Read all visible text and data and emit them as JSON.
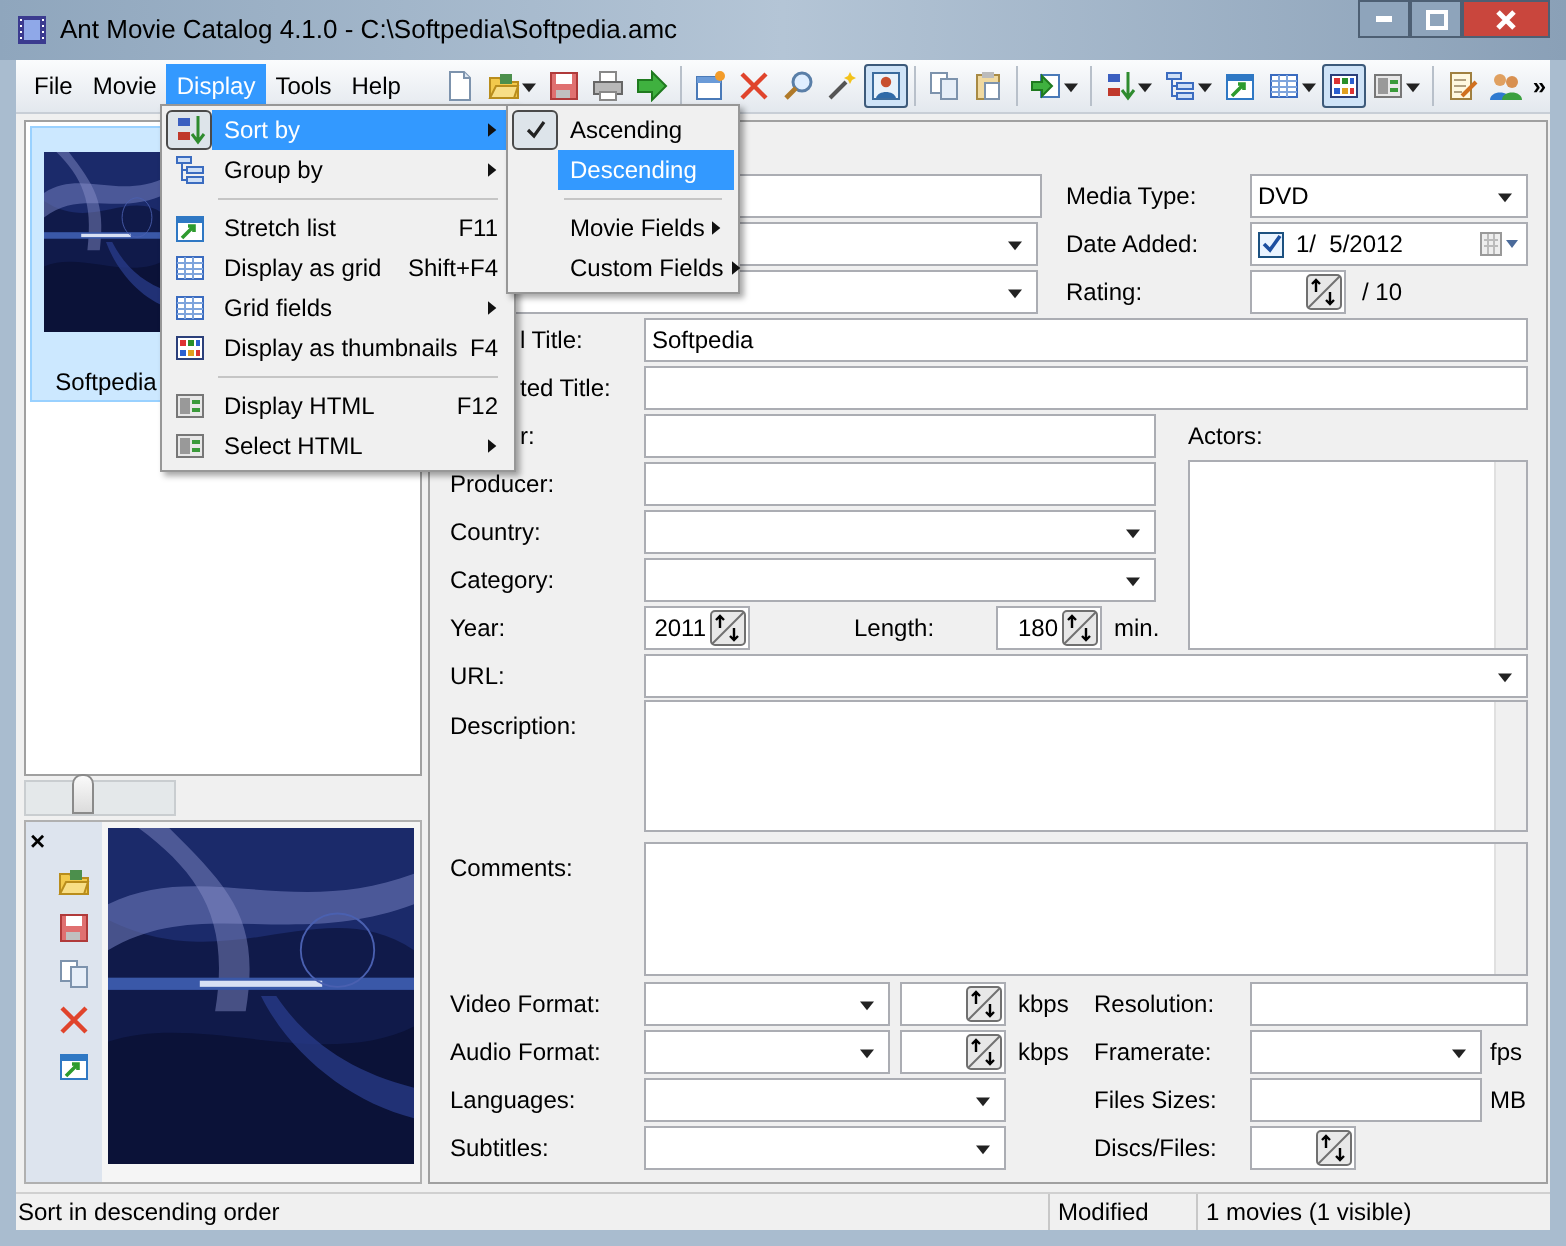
{
  "window": {
    "title": "Ant Movie Catalog 4.1.0 - C:\\Softpedia\\Softpedia.amc"
  },
  "menu_bar": [
    {
      "label": "File",
      "selected": false
    },
    {
      "label": "Movie",
      "selected": false
    },
    {
      "label": "Display",
      "selected": true
    },
    {
      "label": "Tools",
      "selected": false
    },
    {
      "label": "Help",
      "selected": false
    }
  ],
  "toolbar": [
    {
      "kind": "new",
      "selected": false,
      "dropdown": false
    },
    {
      "kind": "open",
      "selected": false,
      "dropdown": true
    },
    {
      "kind": "save",
      "selected": false,
      "dropdown": false
    },
    {
      "kind": "print",
      "selected": false,
      "dropdown": false
    },
    {
      "kind": "run",
      "selected": false,
      "dropdown": false
    },
    {
      "kind": "sep"
    },
    {
      "kind": "add",
      "selected": false,
      "dropdown": false
    },
    {
      "kind": "delete",
      "selected": false,
      "dropdown": false
    },
    {
      "kind": "find",
      "selected": false,
      "dropdown": false
    },
    {
      "kind": "wand",
      "selected": false,
      "dropdown": false
    },
    {
      "kind": "portrait",
      "selected": true,
      "dropdown": false
    },
    {
      "kind": "sep"
    },
    {
      "kind": "copy",
      "selected": false,
      "dropdown": false
    },
    {
      "kind": "paste",
      "selected": false,
      "dropdown": false
    },
    {
      "kind": "sep"
    },
    {
      "kind": "import",
      "selected": false,
      "dropdown": true
    },
    {
      "kind": "sep"
    },
    {
      "kind": "sort",
      "selected": false,
      "dropdown": true
    },
    {
      "kind": "tree",
      "selected": false,
      "dropdown": true
    },
    {
      "kind": "stretch",
      "selected": false,
      "dropdown": false
    },
    {
      "kind": "grid",
      "selected": false,
      "dropdown": true
    },
    {
      "kind": "thumbs",
      "selected": true,
      "dropdown": false
    },
    {
      "kind": "html",
      "selected": false,
      "dropdown": true
    },
    {
      "kind": "sep"
    },
    {
      "kind": "edit",
      "selected": false,
      "dropdown": false
    },
    {
      "kind": "people",
      "selected": false,
      "dropdown": false
    }
  ],
  "toolbar_overflow": "»",
  "display_menu": [
    {
      "kind": "item",
      "label": "Sort by",
      "submenu": true,
      "selected": true
    },
    {
      "kind": "item",
      "label": "Group by",
      "submenu": true,
      "selected": false
    },
    {
      "kind": "separator"
    },
    {
      "kind": "item",
      "label": "Stretch list",
      "shortcut": "F11",
      "selected": false
    },
    {
      "kind": "item",
      "label": "Display as grid",
      "shortcut": "Shift+F4",
      "selected": false
    },
    {
      "kind": "item",
      "label": "Grid fields",
      "submenu": true,
      "selected": false
    },
    {
      "kind": "item",
      "label": "Display as thumbnails",
      "shortcut": "F4",
      "selected": false
    },
    {
      "kind": "separator"
    },
    {
      "kind": "item",
      "label": "Display HTML",
      "shortcut": "F12",
      "selected": false
    },
    {
      "kind": "item",
      "label": "Select HTML",
      "submenu": true,
      "selected": false
    }
  ],
  "sort_submenu": [
    {
      "kind": "item",
      "label": "Ascending",
      "checked": true,
      "selected": false
    },
    {
      "kind": "item",
      "label": "Descending",
      "checked": false,
      "selected": true
    },
    {
      "kind": "separator"
    },
    {
      "kind": "item",
      "label": "Movie Fields",
      "submenu": true,
      "selected": false
    },
    {
      "kind": "item",
      "label": "Custom Fields",
      "submenu": true,
      "selected": false
    }
  ],
  "movie_list": {
    "items": [
      {
        "title": "Softpedia",
        "selected": true
      }
    ],
    "thumb_size": {
      "level": 0.37
    }
  },
  "side_toolbar": {
    "close": "×"
  },
  "form": {
    "top_rows": [
      {
        "left_field": {
          "kind": "text"
        },
        "label": "Media Type:",
        "control": {
          "kind": "dropdown",
          "value": "DVD"
        }
      },
      {
        "left_field": {
          "kind": "dropdown"
        },
        "label": "Date Added:",
        "control": {
          "kind": "date",
          "checked": true,
          "value": "1/  5/2012"
        }
      },
      {
        "left_field": {
          "kind": "dropdown"
        },
        "label": "Rating:",
        "control": {
          "kind": "spin",
          "unit": "/ 10"
        }
      }
    ],
    "titles": [
      {
        "label": "l Title:",
        "value": "Softpedia"
      },
      {
        "label": "ted Title:"
      }
    ],
    "people": [
      {
        "label": "r:",
        "kind": "text"
      },
      {
        "label": "Producer:",
        "kind": "text"
      },
      {
        "label": "Country:",
        "kind": "dropdown"
      },
      {
        "label": "Category:",
        "kind": "dropdown"
      }
    ],
    "actors": {
      "label": "Actors:"
    },
    "year": {
      "label": "Year:",
      "value": "2011"
    },
    "length": {
      "label": "Length:",
      "value": "180",
      "unit": "min."
    },
    "url": {
      "label": "URL:"
    },
    "description": {
      "label": "Description:"
    },
    "comments": {
      "label": "Comments:"
    },
    "media_rows": [
      {
        "label": "Video Format:",
        "kind": "dropdown",
        "rate_unit": "kbps",
        "right_label": "Resolution:",
        "right_control": {
          "kind": "text"
        }
      },
      {
        "label": "Audio Format:",
        "kind": "dropdown",
        "rate_unit": "kbps",
        "right_label": "Framerate:",
        "right_control": {
          "kind": "dropdown"
        },
        "right_unit": "fps"
      },
      {
        "label": "Languages:",
        "kind": "dropdown_wide",
        "right_label": "Files Sizes:",
        "right_control": {
          "kind": "text"
        },
        "right_unit": "MB"
      },
      {
        "label": "Subtitles:",
        "kind": "dropdown_wide",
        "right_label": "Discs/Files:",
        "right_control": {
          "kind": "spin"
        }
      }
    ]
  },
  "status_bar": {
    "hint": "Sort in descending order",
    "state": "Modified",
    "count": "1 movies (1 visible)"
  }
}
